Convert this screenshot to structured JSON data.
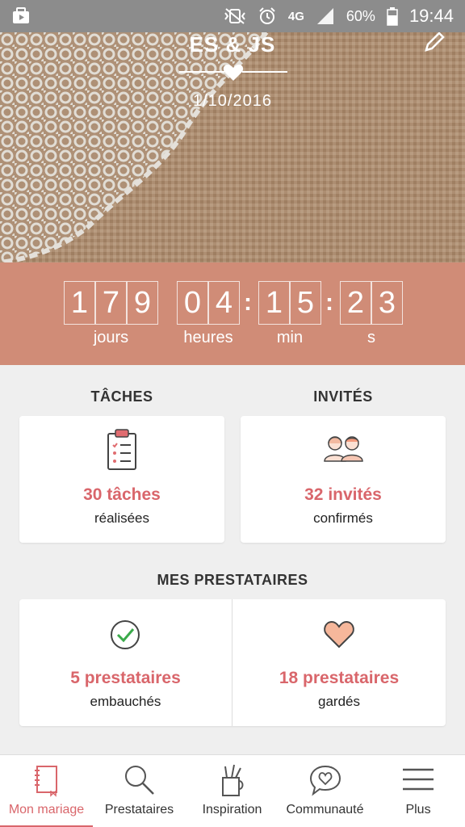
{
  "status_bar": {
    "battery": "60%",
    "network": "4G",
    "time": "19:44"
  },
  "hero": {
    "title": "ES & JS",
    "date": "1/10/2016"
  },
  "countdown": {
    "days": [
      "1",
      "7",
      "9"
    ],
    "hours": [
      "0",
      "4"
    ],
    "minutes": [
      "1",
      "5"
    ],
    "seconds": [
      "2",
      "3"
    ],
    "labels": {
      "days": "jours",
      "hours": "heures",
      "minutes": "min",
      "seconds": "s"
    }
  },
  "tasks": {
    "title": "TÂCHES",
    "count": "30 tâches",
    "status": "réalisées"
  },
  "guests": {
    "title": "INVITÉS",
    "count": "32 invités",
    "status": "confirmés"
  },
  "vendors": {
    "title": "MES PRESTATAIRES",
    "hired_count": "5 prestataires",
    "hired_status": "embauchés",
    "saved_count": "18 prestataires",
    "saved_status": "gardés"
  },
  "nav": {
    "items": [
      {
        "label": "Mon mariage",
        "icon": "notebook-icon"
      },
      {
        "label": "Prestataires",
        "icon": "search-icon"
      },
      {
        "label": "Inspiration",
        "icon": "pencil-cup-icon"
      },
      {
        "label": "Communauté",
        "icon": "heart-chat-icon"
      },
      {
        "label": "Plus",
        "icon": "menu-icon"
      }
    ]
  },
  "colors": {
    "accent": "#d9666b",
    "countdown_bg": "#d08c77",
    "status_bar": "#8c8c8c"
  }
}
